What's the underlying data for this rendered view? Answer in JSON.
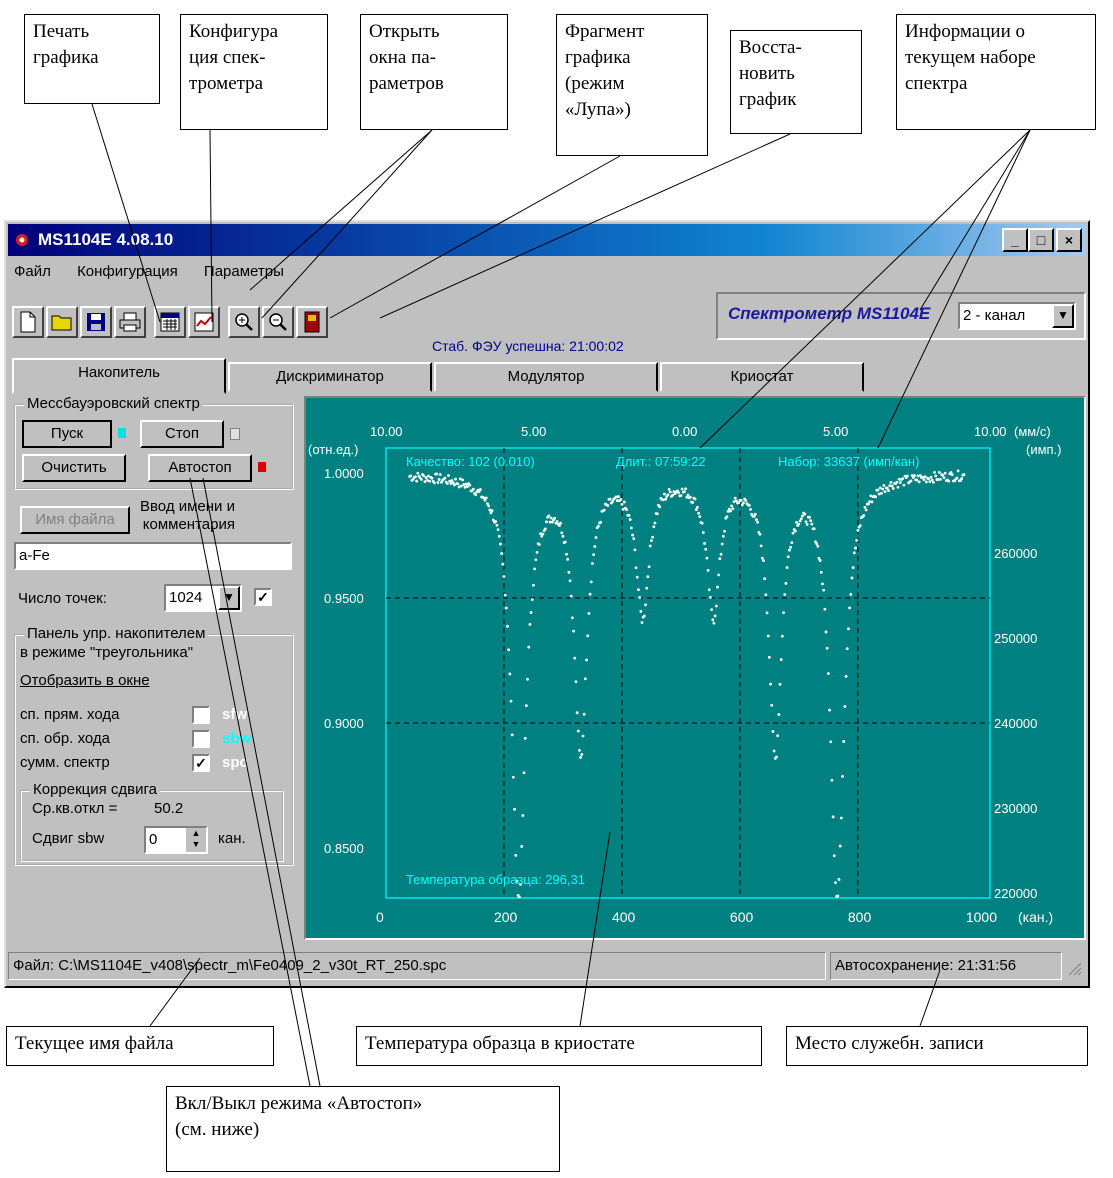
{
  "callouts": {
    "print": "Печать\nграфика",
    "config": "Конфигура\nция спек-\nтрометра",
    "params": "Открыть\nокна па-\nраметров",
    "fragment": "Фрагмент\nграфика\n(режим\n«Лупа»)",
    "restore": "Восста-\nновить\nграфик",
    "info": "Информации о\nтекущем наборе\nспектра",
    "filename": "Текущее имя файла",
    "temp": "Температура образца в криостате",
    "service": "Место служебн. записи",
    "autostop": "Вкл/Выкл режима «Автостоп»\n(см. ниже)"
  },
  "window": {
    "title": "MS1104E 4.08.10",
    "menu": [
      "Файл",
      "Конфигурация",
      "Параметры"
    ],
    "brand": "Спектрометр MS1104E",
    "channel": "2 - канал",
    "status_msg": "Стаб. ФЭУ успешна: 21:00:02",
    "tabs": [
      "Накопитель",
      "Дискриминатор",
      "Модулятор",
      "Криостат"
    ]
  },
  "left": {
    "group1_title": "Мессбауэровский спектр",
    "start": "Пуск",
    "stop": "Стоп",
    "clear": "Очистить",
    "autostop": "Автостоп",
    "filename_btn": "Имя файла",
    "hint": "Ввод имени и\nкомментария",
    "file_value": "a-Fe",
    "points_label": "Число точек:",
    "points_value": "1024",
    "group2_title": "Панель упр. накопителем",
    "group2_sub": "в режиме \"треугольника\"",
    "show_label": "Отобразить в окне",
    "rows": [
      {
        "label": "сп. прям. хода",
        "tag": "sfw",
        "checked": false,
        "color": "#ffffff"
      },
      {
        "label": "сп. обр. хода",
        "tag": "sbw",
        "checked": false,
        "color": "#00ffff"
      },
      {
        "label": "сумм. спектр",
        "tag": "spc",
        "checked": true,
        "color": "#ffffff"
      }
    ],
    "corr_title": "Коррекция сдвига",
    "avg_label": "Ср.кв.откл =",
    "avg_value": "50.2",
    "shift_label": "Сдвиг sbw",
    "shift_value": "0",
    "shift_unit": "кан."
  },
  "plot": {
    "quality": "Качество: 102 (0.010)",
    "duration": "Длит.: 07:59:22",
    "count": "Набор: 33637 (имп/кан)",
    "temperature": "Температура образца: 296,31",
    "top_unit": "(мм/с)",
    "left_unit": "(отн.ед.)",
    "right_unit": "(имп.)",
    "bottom_unit": "(кан.)",
    "top_ticks": [
      "10.00",
      "5.00",
      "0.00",
      "5.00",
      "10.00"
    ],
    "left_ticks": [
      "1.0000",
      "0.9500",
      "0.9000",
      "0.8500"
    ],
    "right_ticks": [
      "260000",
      "250000",
      "240000",
      "230000",
      "220000"
    ],
    "bottom_ticks": [
      "0",
      "200",
      "400",
      "600",
      "800",
      "1000"
    ]
  },
  "status": {
    "file": "Файл: C:\\MS1104E_v408\\spectr_m\\Fe0409_2_v30t_RT_250.spc",
    "autosave": "Автосохранение: 21:31:56"
  },
  "chart_data": {
    "type": "scatter",
    "title": "",
    "xlabel": "(кан.)",
    "ylabel": "(отн.ед.)",
    "xlim": [
      0,
      1024
    ],
    "ylim": [
      0.83,
      1.01
    ],
    "baseline": 1.0,
    "sextet_lines": [
      {
        "x": 225,
        "depth": 0.168,
        "width": 14
      },
      {
        "x": 330,
        "depth": 0.11,
        "width": 13
      },
      {
        "x": 435,
        "depth": 0.055,
        "width": 13
      },
      {
        "x": 555,
        "depth": 0.055,
        "width": 13
      },
      {
        "x": 660,
        "depth": 0.11,
        "width": 13
      },
      {
        "x": 765,
        "depth": 0.168,
        "width": 14
      }
    ],
    "grid": true
  }
}
